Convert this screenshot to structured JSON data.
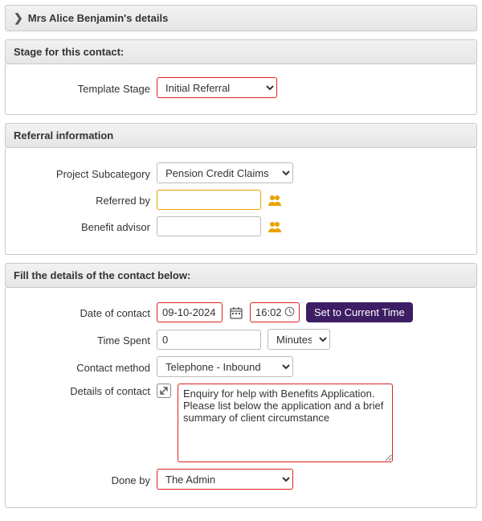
{
  "details_panel": {
    "title": "Mrs Alice Benjamin's details"
  },
  "stage_panel": {
    "header": "Stage for this contact:",
    "template_stage_label": "Template Stage",
    "template_stage_value": "Initial Referral"
  },
  "referral_panel": {
    "header": "Referral information",
    "project_subcategory_label": "Project Subcategory",
    "project_subcategory_value": "Pension Credit Claims",
    "referred_by_label": "Referred by",
    "referred_by_value": "",
    "benefit_advisor_label": "Benefit advisor",
    "benefit_advisor_value": ""
  },
  "contact_panel": {
    "header": "Fill the details of the contact below:",
    "date_label": "Date of contact",
    "date_value": "09-10-2024",
    "time_value": "16:02",
    "set_current_time": "Set to Current Time",
    "time_spent_label": "Time Spent",
    "time_spent_value": "0",
    "time_unit_value": "Minutes",
    "contact_method_label": "Contact method",
    "contact_method_value": "Telephone - Inbound",
    "details_label": "Details of contact",
    "details_value": "Enquiry for help with Benefits Application. Please list below the application and a brief summary of client circumstance",
    "done_by_label": "Done by",
    "done_by_value": "The Admin"
  }
}
